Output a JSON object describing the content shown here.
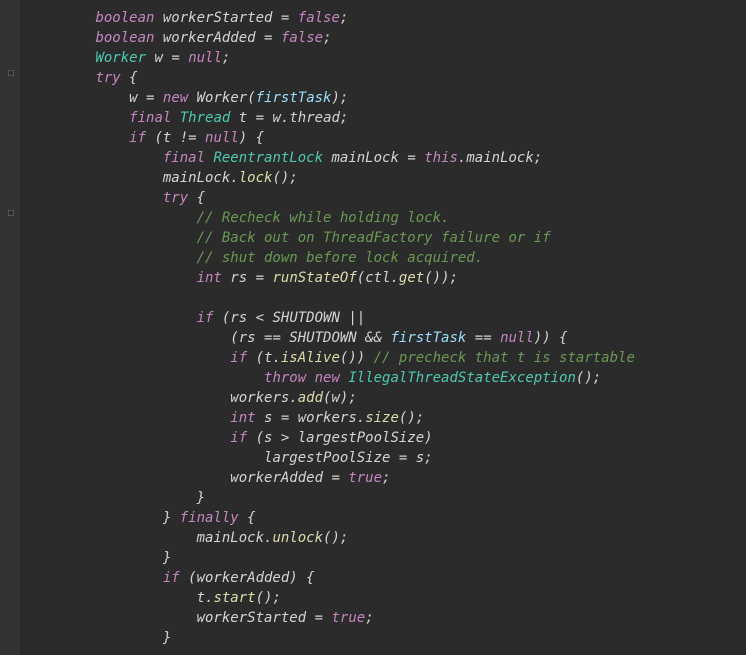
{
  "code": {
    "lines": [
      {
        "indent": 2,
        "tokens": [
          {
            "t": "boolean",
            "c": "kw"
          },
          {
            "t": " workerStarted ",
            "c": "var"
          },
          {
            "t": "=",
            "c": "op"
          },
          {
            "t": " ",
            "c": "var"
          },
          {
            "t": "false",
            "c": "bool"
          },
          {
            "t": ";",
            "c": "var"
          }
        ]
      },
      {
        "indent": 2,
        "tokens": [
          {
            "t": "boolean",
            "c": "kw"
          },
          {
            "t": " workerAdded ",
            "c": "var"
          },
          {
            "t": "=",
            "c": "op"
          },
          {
            "t": " ",
            "c": "var"
          },
          {
            "t": "false",
            "c": "bool"
          },
          {
            "t": ";",
            "c": "var"
          }
        ]
      },
      {
        "indent": 2,
        "tokens": [
          {
            "t": "Worker",
            "c": "type"
          },
          {
            "t": " w ",
            "c": "var"
          },
          {
            "t": "=",
            "c": "op"
          },
          {
            "t": " ",
            "c": "var"
          },
          {
            "t": "null",
            "c": "null"
          },
          {
            "t": ";",
            "c": "var"
          }
        ]
      },
      {
        "indent": 2,
        "tokens": [
          {
            "t": "try",
            "c": "kw"
          },
          {
            "t": " {",
            "c": "var"
          }
        ]
      },
      {
        "indent": 3,
        "tokens": [
          {
            "t": "w ",
            "c": "var"
          },
          {
            "t": "=",
            "c": "op"
          },
          {
            "t": " ",
            "c": "var"
          },
          {
            "t": "new",
            "c": "kw"
          },
          {
            "t": " Worker(",
            "c": "var"
          },
          {
            "t": "firstTask",
            "c": "param"
          },
          {
            "t": ");",
            "c": "var"
          }
        ]
      },
      {
        "indent": 3,
        "tokens": [
          {
            "t": "final",
            "c": "kw"
          },
          {
            "t": " ",
            "c": "var"
          },
          {
            "t": "Thread",
            "c": "type"
          },
          {
            "t": " t ",
            "c": "var"
          },
          {
            "t": "=",
            "c": "op"
          },
          {
            "t": " w.thread;",
            "c": "var"
          }
        ]
      },
      {
        "indent": 3,
        "tokens": [
          {
            "t": "if",
            "c": "kw"
          },
          {
            "t": " (t ",
            "c": "var"
          },
          {
            "t": "!=",
            "c": "op"
          },
          {
            "t": " ",
            "c": "var"
          },
          {
            "t": "null",
            "c": "null"
          },
          {
            "t": ") {",
            "c": "var"
          }
        ]
      },
      {
        "indent": 4,
        "tokens": [
          {
            "t": "final",
            "c": "kw"
          },
          {
            "t": " ",
            "c": "var"
          },
          {
            "t": "ReentrantLock",
            "c": "type"
          },
          {
            "t": " mainLock ",
            "c": "var"
          },
          {
            "t": "=",
            "c": "op"
          },
          {
            "t": " ",
            "c": "var"
          },
          {
            "t": "this",
            "c": "this"
          },
          {
            "t": ".mainLock;",
            "c": "var"
          }
        ]
      },
      {
        "indent": 4,
        "tokens": [
          {
            "t": "mainLock.",
            "c": "var"
          },
          {
            "t": "lock",
            "c": "method"
          },
          {
            "t": "();",
            "c": "var"
          }
        ]
      },
      {
        "indent": 4,
        "tokens": [
          {
            "t": "try",
            "c": "kw"
          },
          {
            "t": " {",
            "c": "var"
          }
        ]
      },
      {
        "indent": 5,
        "tokens": [
          {
            "t": "// Recheck while holding lock.",
            "c": "comment"
          }
        ]
      },
      {
        "indent": 5,
        "tokens": [
          {
            "t": "// Back out on ThreadFactory failure or if",
            "c": "comment"
          }
        ]
      },
      {
        "indent": 5,
        "tokens": [
          {
            "t": "// shut down before lock acquired.",
            "c": "comment"
          }
        ]
      },
      {
        "indent": 5,
        "tokens": [
          {
            "t": "int",
            "c": "kw"
          },
          {
            "t": " rs ",
            "c": "var"
          },
          {
            "t": "=",
            "c": "op"
          },
          {
            "t": " ",
            "c": "var"
          },
          {
            "t": "runStateOf",
            "c": "method"
          },
          {
            "t": "(ctl.",
            "c": "var"
          },
          {
            "t": "get",
            "c": "method"
          },
          {
            "t": "());",
            "c": "var"
          }
        ]
      },
      {
        "indent": 5,
        "tokens": [
          {
            "t": "",
            "c": "var"
          }
        ]
      },
      {
        "indent": 5,
        "tokens": [
          {
            "t": "if",
            "c": "kw"
          },
          {
            "t": " (rs ",
            "c": "var"
          },
          {
            "t": "<",
            "c": "op"
          },
          {
            "t": " SHUTDOWN ",
            "c": "var"
          },
          {
            "t": "||",
            "c": "op"
          }
        ]
      },
      {
        "indent": 6,
        "tokens": [
          {
            "t": "(rs ",
            "c": "var"
          },
          {
            "t": "==",
            "c": "op"
          },
          {
            "t": " SHUTDOWN ",
            "c": "var"
          },
          {
            "t": "&&",
            "c": "op"
          },
          {
            "t": " ",
            "c": "var"
          },
          {
            "t": "firstTask",
            "c": "param"
          },
          {
            "t": " ",
            "c": "var"
          },
          {
            "t": "==",
            "c": "op"
          },
          {
            "t": " ",
            "c": "var"
          },
          {
            "t": "null",
            "c": "null"
          },
          {
            "t": ")) {",
            "c": "var"
          }
        ]
      },
      {
        "indent": 6,
        "tokens": [
          {
            "t": "if",
            "c": "kw"
          },
          {
            "t": " (t.",
            "c": "var"
          },
          {
            "t": "isAlive",
            "c": "method"
          },
          {
            "t": "()) ",
            "c": "var"
          },
          {
            "t": "// precheck that t is startable",
            "c": "comment"
          }
        ]
      },
      {
        "indent": 7,
        "tokens": [
          {
            "t": "throw",
            "c": "kw"
          },
          {
            "t": " ",
            "c": "var"
          },
          {
            "t": "new",
            "c": "kw"
          },
          {
            "t": " ",
            "c": "var"
          },
          {
            "t": "IllegalThreadStateException",
            "c": "class"
          },
          {
            "t": "();",
            "c": "var"
          }
        ]
      },
      {
        "indent": 6,
        "tokens": [
          {
            "t": "workers.",
            "c": "var"
          },
          {
            "t": "add",
            "c": "method"
          },
          {
            "t": "(w);",
            "c": "var"
          }
        ]
      },
      {
        "indent": 6,
        "tokens": [
          {
            "t": "int",
            "c": "kw"
          },
          {
            "t": " s ",
            "c": "var"
          },
          {
            "t": "=",
            "c": "op"
          },
          {
            "t": " workers.",
            "c": "var"
          },
          {
            "t": "size",
            "c": "method"
          },
          {
            "t": "();",
            "c": "var"
          }
        ]
      },
      {
        "indent": 6,
        "tokens": [
          {
            "t": "if",
            "c": "kw"
          },
          {
            "t": " (s ",
            "c": "var"
          },
          {
            "t": ">",
            "c": "op"
          },
          {
            "t": " largestPoolSize)",
            "c": "var"
          }
        ]
      },
      {
        "indent": 7,
        "tokens": [
          {
            "t": "largestPoolSize ",
            "c": "var"
          },
          {
            "t": "=",
            "c": "op"
          },
          {
            "t": " s;",
            "c": "var"
          }
        ]
      },
      {
        "indent": 6,
        "tokens": [
          {
            "t": "workerAdded ",
            "c": "var"
          },
          {
            "t": "=",
            "c": "op"
          },
          {
            "t": " ",
            "c": "var"
          },
          {
            "t": "true",
            "c": "bool"
          },
          {
            "t": ";",
            "c": "var"
          }
        ]
      },
      {
        "indent": 5,
        "tokens": [
          {
            "t": "}",
            "c": "var"
          }
        ]
      },
      {
        "indent": 4,
        "tokens": [
          {
            "t": "} ",
            "c": "var"
          },
          {
            "t": "finally",
            "c": "kw"
          },
          {
            "t": " {",
            "c": "var"
          }
        ]
      },
      {
        "indent": 5,
        "tokens": [
          {
            "t": "mainLock.",
            "c": "var"
          },
          {
            "t": "unlock",
            "c": "method"
          },
          {
            "t": "();",
            "c": "var"
          }
        ]
      },
      {
        "indent": 4,
        "tokens": [
          {
            "t": "}",
            "c": "var"
          }
        ]
      },
      {
        "indent": 4,
        "tokens": [
          {
            "t": "if",
            "c": "kw"
          },
          {
            "t": " (workerAdded) {",
            "c": "var"
          }
        ]
      },
      {
        "indent": 5,
        "tokens": [
          {
            "t": "t.",
            "c": "var"
          },
          {
            "t": "start",
            "c": "method"
          },
          {
            "t": "();",
            "c": "var"
          }
        ]
      },
      {
        "indent": 5,
        "tokens": [
          {
            "t": "workerStarted ",
            "c": "var"
          },
          {
            "t": "=",
            "c": "op"
          },
          {
            "t": " ",
            "c": "var"
          },
          {
            "t": "true",
            "c": "bool"
          },
          {
            "t": ";",
            "c": "var"
          }
        ]
      },
      {
        "indent": 4,
        "tokens": [
          {
            "t": "}",
            "c": "var"
          }
        ]
      }
    ],
    "indentUnit": "    "
  }
}
